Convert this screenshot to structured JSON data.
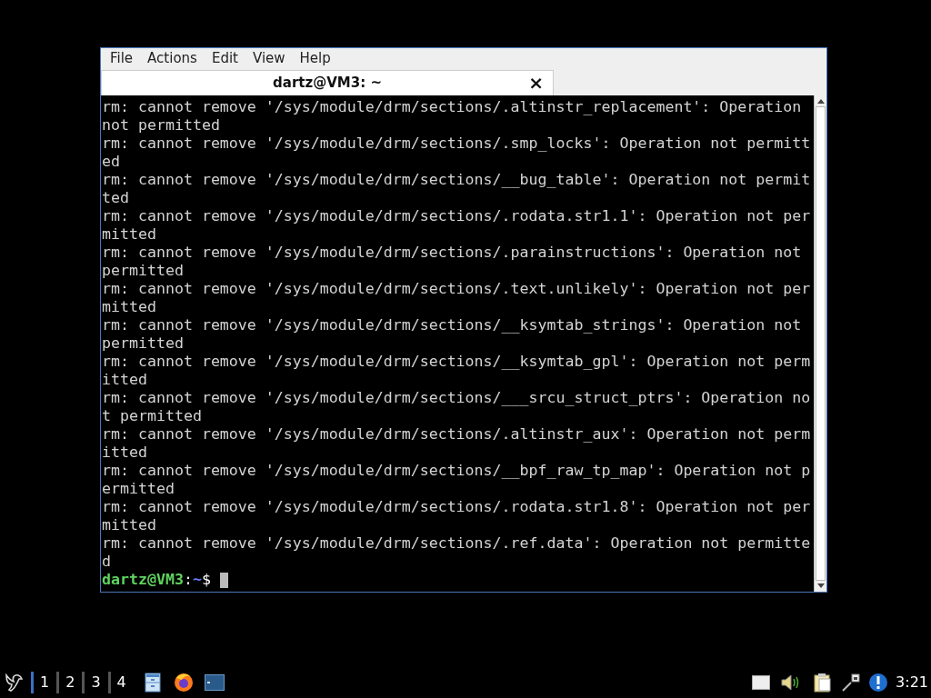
{
  "menu": [
    "File",
    "Actions",
    "Edit",
    "View",
    "Help"
  ],
  "tabs": [
    {
      "title": "dartz@VM3: ~",
      "close": "×",
      "selected": true
    }
  ],
  "terminal": {
    "lines": [
      "rm: cannot remove '/sys/module/drm/sections/.altinstr_replacement': Operation not permitted",
      "rm: cannot remove '/sys/module/drm/sections/.smp_locks': Operation not permitted",
      "rm: cannot remove '/sys/module/drm/sections/__bug_table': Operation not permitted",
      "rm: cannot remove '/sys/module/drm/sections/.rodata.str1.1': Operation not permitted",
      "rm: cannot remove '/sys/module/drm/sections/.parainstructions': Operation not permitted",
      "rm: cannot remove '/sys/module/drm/sections/.text.unlikely': Operation not permitted",
      "rm: cannot remove '/sys/module/drm/sections/__ksymtab_strings': Operation not permitted",
      "rm: cannot remove '/sys/module/drm/sections/__ksymtab_gpl': Operation not permitted",
      "rm: cannot remove '/sys/module/drm/sections/___srcu_struct_ptrs': Operation not permitted",
      "rm: cannot remove '/sys/module/drm/sections/.altinstr_aux': Operation not permitted",
      "rm: cannot remove '/sys/module/drm/sections/__bpf_raw_tp_map': Operation not permitted",
      "rm: cannot remove '/sys/module/drm/sections/.rodata.str1.8': Operation not permitted",
      "rm: cannot remove '/sys/module/drm/sections/.ref.data': Operation not permitted"
    ],
    "prompt": {
      "user_host": "dartz@VM3",
      "separator": ":",
      "path": "~",
      "symbol": "$"
    }
  },
  "taskbar": {
    "desktops": [
      {
        "label": "1",
        "selected": true
      },
      {
        "label": "2",
        "selected": false
      },
      {
        "label": "3",
        "selected": false
      },
      {
        "label": "4",
        "selected": false
      }
    ],
    "clock": "3:21"
  }
}
